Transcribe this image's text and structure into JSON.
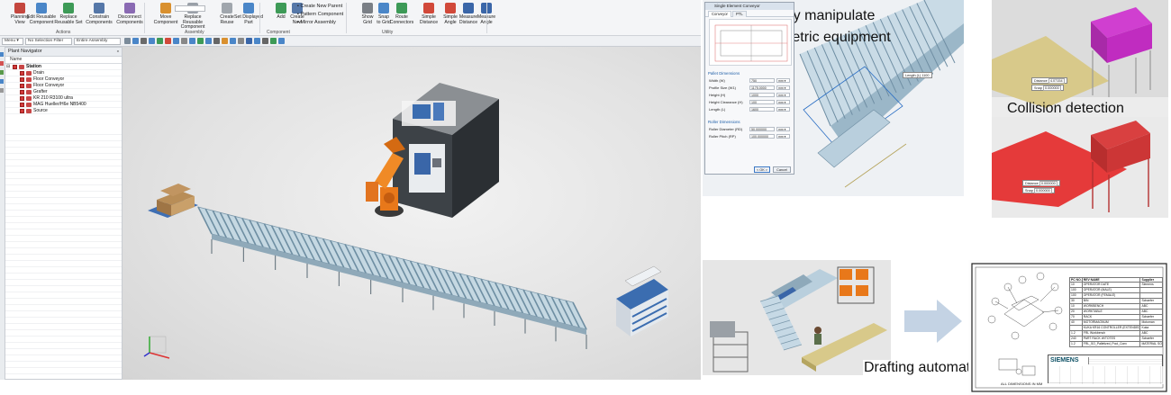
{
  "ribbon": {
    "buttons": [
      {
        "id": "planning",
        "label": "Planning\nView"
      },
      {
        "id": "edit_reusable",
        "label": "Edit Reusable\nComponent"
      },
      {
        "id": "replace_reusable",
        "label": "Replace\nReusable Set"
      },
      {
        "id": "constrain",
        "label": "Constrain\nComponents"
      },
      {
        "id": "disconnect",
        "label": "Disconnect\nComponents"
      },
      {
        "id": "move",
        "label": "Move\nComponent"
      },
      {
        "id": "replace_assembly",
        "label": "Replace Reusable\nComponent"
      },
      {
        "id": "create_reuse",
        "label": "Create\nReuse"
      },
      {
        "id": "set_displayed",
        "label": "Set Displayed\nPart"
      },
      {
        "id": "add",
        "label": "Add"
      },
      {
        "id": "create_new",
        "label": "Create\nNew"
      },
      {
        "id": "show_grid",
        "label": "Show\nGrid"
      },
      {
        "id": "snap",
        "label": "Snap\nto Grid"
      },
      {
        "id": "route",
        "label": "Route\nConnectors"
      },
      {
        "id": "simple_distance",
        "label": "Simple\nDistance"
      },
      {
        "id": "simple_angle",
        "label": "Simple\nAngle"
      },
      {
        "id": "measure_distance",
        "label": "Measure\nDistance"
      },
      {
        "id": "measure_angle",
        "label": "Measure\nAngle"
      }
    ],
    "small": {
      "create_new_parent": "Create New Parent",
      "pattern": "Pattern Component",
      "mirror": "Mirror Assembly"
    },
    "groups": {
      "actions": "Actions",
      "assembly": "Assembly",
      "component": "Component",
      "utility": "Utility"
    }
  },
  "toolbar": {
    "menu": "Menu",
    "filter": "No Selection Filter",
    "scope": "Entire Assembly"
  },
  "navigator": {
    "title": "Plant Navigator",
    "column": "Name",
    "items": [
      {
        "label": "Station",
        "level": 0,
        "bold": true
      },
      {
        "label": "Drain",
        "level": 1
      },
      {
        "label": "Floor Conveyor",
        "level": 1
      },
      {
        "label": "Floor Conveyor",
        "level": 1
      },
      {
        "label": "Grafter",
        "level": 1
      },
      {
        "label": "KR 210 R3100 ultra",
        "level": 1
      },
      {
        "label": "MAG Hueller/H6e NB5400",
        "level": 1
      },
      {
        "label": "Source",
        "level": 1
      }
    ]
  },
  "captions": {
    "parametric": "Easily manipulate\nparametric equipment",
    "collision": "Collision detection",
    "drafting": "Drafting automation"
  },
  "dialog": {
    "title": "Single Element Conveyor",
    "tabs": [
      "Conveyor",
      "PTL"
    ],
    "sections": [
      "Pallet Dimensions",
      "Roller Dimensions"
    ],
    "rows": [
      {
        "label": "Width (W)",
        "value": "750",
        "unit": "mm"
      },
      {
        "label": "Profile Size (W1)",
        "value": "1175.0000",
        "unit": "mm"
      },
      {
        "label": "Height (H)",
        "value": "1000",
        "unit": "mm"
      },
      {
        "label": "Height Clearance (H)",
        "value": "100",
        "unit": "mm"
      },
      {
        "label": "Length (L)",
        "value": "1600",
        "unit": "mm"
      }
    ],
    "roller_rows": [
      {
        "label": "Roller Diameter (RD)",
        "value": "50.000000",
        "unit": "mm"
      },
      {
        "label": "Roller Pitch (RP)",
        "value": "100.000000",
        "unit": "mm"
      }
    ],
    "ok": "< OK >",
    "cancel": "Cancel",
    "length_tag": "Length (L) 1100"
  },
  "collision": {
    "distance_top_label": "Distance",
    "distance_top_value": "4.07154",
    "snap_label": "Snap",
    "snap_value": "0.000000",
    "distance_bottom_label": "Distance",
    "distance_bottom_value": "0.000000",
    "snap_bottom_value": "0.000000"
  },
  "drawing": {
    "brand": "SIEMENS",
    "footer": "ALL DIMENSIONS IN MM",
    "bom_header": [
      "PC NO.",
      "REV NAME",
      "Supplier"
    ],
    "bom": [
      [
        "10",
        "OPERATOR DATE",
        "Siemens"
      ],
      [
        "100",
        "OPERATOR (MALE)",
        ""
      ],
      [
        "100",
        "OPERATOR (FEMALE)",
        ""
      ],
      [
        "30",
        "BIN",
        "Schaefer"
      ],
      [
        "10",
        "WORKBENCH",
        "ABC"
      ],
      [
        "20",
        "WORKTABLE",
        "ABC"
      ],
      [
        "70",
        "RACK",
        "Schaefer"
      ],
      [
        "40",
        "MOTORMAGNUM",
        "Motoman"
      ],
      [
        "",
        "KUKA KR16 CONTROLLER (EXTENDED)",
        "Kuka"
      ],
      [
        "1.2",
        "FRL Workbench",
        "ABC"
      ],
      [
        "240",
        "PART RACK W/TOTES",
        "Schaefer"
      ],
      [
        "1.2",
        "FRL_SO_Palletized_Pool_Conv",
        "MATERIAL SOLUTIONS"
      ]
    ]
  },
  "colors": {
    "accent": "#1f5fa8",
    "robot": "#e8781a",
    "conveyor": "#a9c7d6",
    "collision": "#e53a3a",
    "ok_box": "#c02cc0",
    "arrow": "#c4d3e4"
  }
}
